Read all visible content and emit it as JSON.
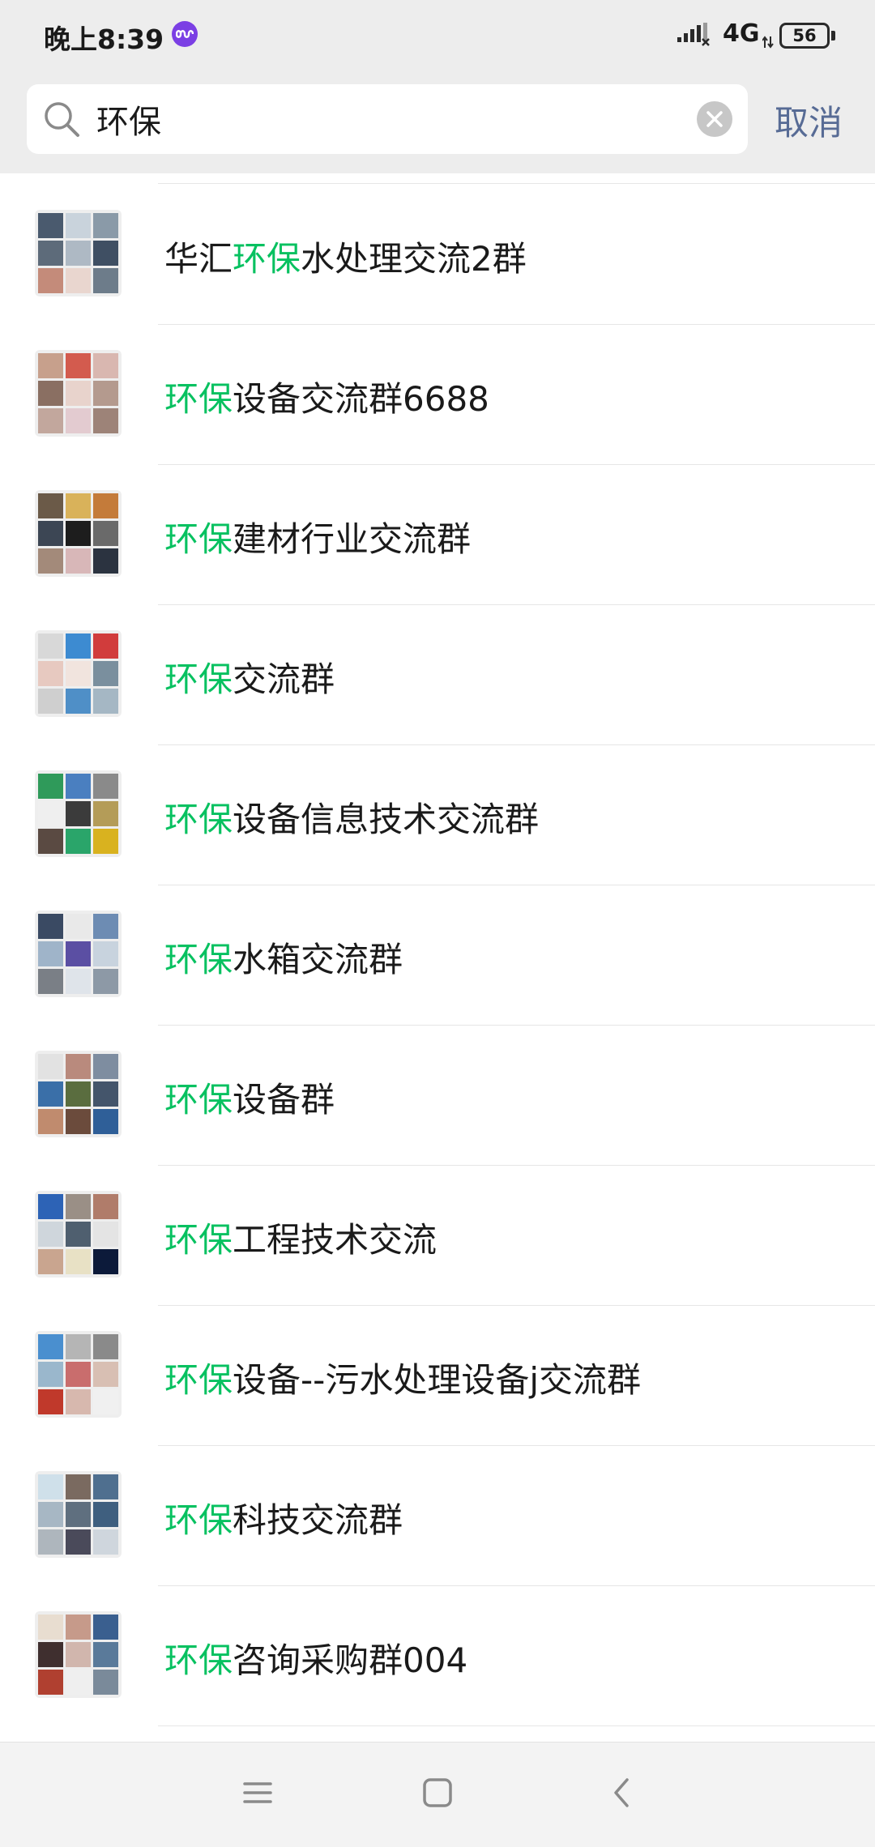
{
  "status_bar": {
    "time": "晚上8:39",
    "network": "4G",
    "battery": "56",
    "icons": [
      "infinity-app-icon",
      "signal-icon",
      "network-arrows-icon",
      "battery-icon"
    ]
  },
  "search": {
    "query": "环保",
    "cancel_label": "取消",
    "icons": [
      "search-icon",
      "clear-icon"
    ]
  },
  "results": [
    {
      "prefix": "华汇",
      "highlight": "环保",
      "suffix": "水处理交流2群",
      "tiles": [
        "#4a5a6e",
        "#c9d3dc",
        "#8a9aa8",
        "#5d6b7a",
        "#aeb9c4",
        "#3f4f63",
        "#c48b7a",
        "#e9d6cf",
        "#6d7c8a"
      ]
    },
    {
      "prefix": "",
      "highlight": "环保",
      "suffix": "设备交流群6688",
      "tiles": [
        "#c7a08c",
        "#d35b4e",
        "#d9b7b0",
        "#8a6f62",
        "#e8d3cc",
        "#b49a8e",
        "#c2a79d",
        "#e3cbd0",
        "#9d8378"
      ]
    },
    {
      "prefix": "",
      "highlight": "环保",
      "suffix": "建材行业交流群",
      "tiles": [
        "#6b5a48",
        "#d9b25a",
        "#c47b3a",
        "#3c4654",
        "#1d1d1d",
        "#6a6a6a",
        "#a38a7a",
        "#d8b7b8",
        "#2b3340"
      ]
    },
    {
      "prefix": "",
      "highlight": "环保",
      "suffix": "交流群",
      "tiles": [
        "#d8d8d8",
        "#3d8bd1",
        "#d13c3c",
        "#e7c9c0",
        "#f1e4de",
        "#7a8f9e",
        "#cfcfcf",
        "#4f8fc7",
        "#a5b7c4"
      ]
    },
    {
      "prefix": "",
      "highlight": "环保",
      "suffix": "设备信息技术交流群",
      "tiles": [
        "#2f9a5a",
        "#4a7fc0",
        "#8a8a8a",
        "#efefef",
        "#3b3b3b",
        "#b49c58",
        "#5a4a42",
        "#2aa56a",
        "#d9b21f"
      ]
    },
    {
      "prefix": "",
      "highlight": "环保",
      "suffix": "水箱交流群",
      "tiles": [
        "#3a4a63",
        "#e9e9e9",
        "#6d8cb3",
        "#9fb4c9",
        "#5b4fa3",
        "#c8d3de",
        "#7a7f86",
        "#dfe4ea",
        "#8d99a6"
      ]
    },
    {
      "prefix": "",
      "highlight": "环保",
      "suffix": "设备群",
      "tiles": [
        "#e2e2e2",
        "#b98a7d",
        "#7e8da0",
        "#3a6fa8",
        "#5a6d3f",
        "#44556b",
        "#c08b6e",
        "#6b4b3c",
        "#2f5f98"
      ]
    },
    {
      "prefix": "",
      "highlight": "环保",
      "suffix": "工程技术交流",
      "tiles": [
        "#2d63b6",
        "#9a8f86",
        "#b07c6a",
        "#cfd6dc",
        "#4f5f6f",
        "#e4e4e4",
        "#c9a58f",
        "#e8e1c5",
        "#0c1a3a"
      ]
    },
    {
      "prefix": "",
      "highlight": "环保",
      "suffix": "设备--污水处理设备j交流群",
      "tiles": [
        "#4a8fcf",
        "#b5b5b5",
        "#8a8a8a",
        "#9ab7cc",
        "#c96d6d",
        "#d8bfb3",
        "#c0392b",
        "#d7b8ae",
        "#f0f0f0"
      ]
    },
    {
      "prefix": "",
      "highlight": "环保",
      "suffix": "科技交流群",
      "tiles": [
        "#cfe0ea",
        "#7a6a60",
        "#4f6f8f",
        "#a7b7c4",
        "#5f6f7f",
        "#3f5f7f",
        "#aeb6bd",
        "#4a4a5a",
        "#cfd6dd"
      ]
    },
    {
      "prefix": "",
      "highlight": "环保",
      "suffix": "咨询采购群004",
      "tiles": [
        "#e8ddd0",
        "#c69a8a",
        "#3a5f8f",
        "#3f2f2f",
        "#d1b6ad",
        "#5a7a9a",
        "#b04030",
        "#efefef",
        "#7a8a9a"
      ]
    }
  ],
  "nav": {
    "icons": [
      "menu-icon",
      "home-square-icon",
      "back-chevron-icon"
    ]
  },
  "colors": {
    "highlight": "#07c160",
    "cancel": "#576b95",
    "header_bg": "#ededed"
  }
}
